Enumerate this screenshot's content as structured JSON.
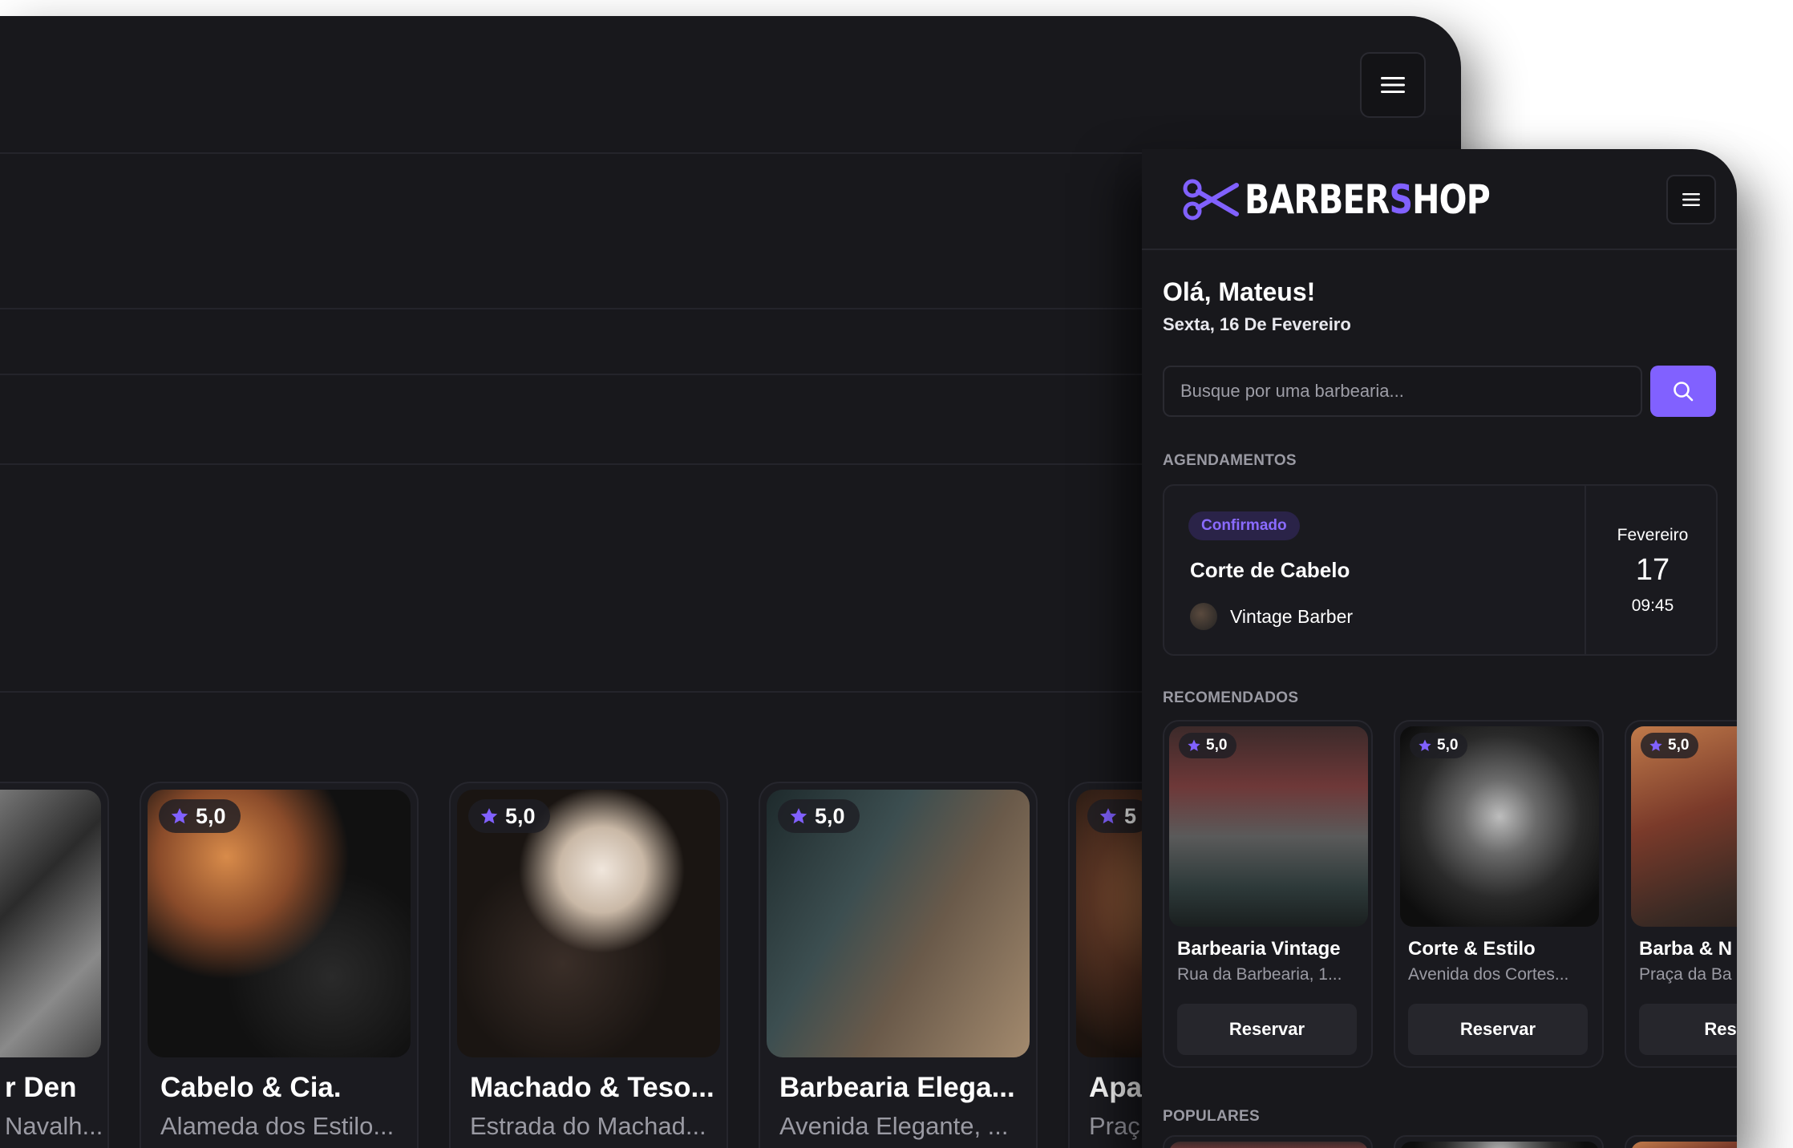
{
  "brand": {
    "logo_main": "BARBER",
    "logo_accent": "S",
    "logo_tail": "HOP",
    "accent_color": "#8161ff"
  },
  "header": {
    "menu_icon": "hamburger-menu-icon"
  },
  "greeting": {
    "title": "Olá, Mateus!",
    "date": "Sexta, 16 De Fevereiro"
  },
  "search": {
    "placeholder": "Busque por uma barbearia...",
    "button_icon": "search-icon"
  },
  "sections": {
    "bookings": "AGENDAMENTOS",
    "recommended": "RECOMENDADOS",
    "popular": "POPULARES"
  },
  "booking": {
    "status": "Confirmado",
    "service": "Corte de Cabelo",
    "shop": "Vintage Barber",
    "month": "Fevereiro",
    "day": "17",
    "time": "09:45"
  },
  "recommended": [
    {
      "rating": "5,0",
      "name": "Barbearia Vintage",
      "address": "Rua da Barbearia, 1...",
      "button": "Reservar"
    },
    {
      "rating": "5,0",
      "name": "Corte & Estilo",
      "address": "Avenida dos Cortes...",
      "button": "Reservar"
    },
    {
      "rating": "5,0",
      "name": "Barba & N",
      "address": "Praça da Ba",
      "button": "Reser"
    }
  ],
  "desktop_cards": [
    {
      "rating": "",
      "name": "r Den",
      "address": "Navalh..."
    },
    {
      "rating": "5,0",
      "name": "Cabelo & Cia.",
      "address": "Alameda dos Estilo..."
    },
    {
      "rating": "5,0",
      "name": "Machado & Teso...",
      "address": "Estrada do Machad..."
    },
    {
      "rating": "5,0",
      "name": "Barbearia Elega...",
      "address": "Avenida Elegante, ..."
    },
    {
      "rating": "5",
      "name": "Apa",
      "address": "Praç"
    }
  ]
}
